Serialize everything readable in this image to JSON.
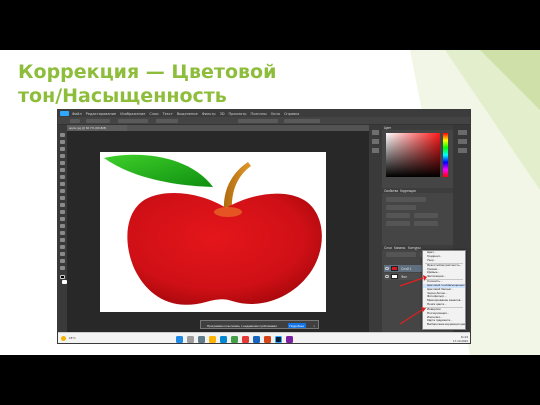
{
  "slide": {
    "title_line1": "Коррекция — Цветовой",
    "title_line2": "тон/Насыщенность",
    "accent_color": "#8dbd3b"
  },
  "photoshop": {
    "menu": [
      "Файл",
      "Редактирование",
      "Изображение",
      "Слои",
      "Текст",
      "Выделение",
      "Фильтр",
      "3D",
      "Просмотр",
      "Плагины",
      "Окно",
      "Справка"
    ],
    "document_tab": "apple.jpg @ 66.7% (RGB/8)",
    "panels": {
      "color_tab": "Цвет",
      "adjustments_tabs": [
        "Свойства",
        "Коррекция"
      ],
      "layers_tabs": [
        "Слои",
        "Каналы",
        "Контуры"
      ],
      "layers": [
        {
          "name": "Слой 1"
        },
        {
          "name": "Фон"
        }
      ]
    },
    "context_menu": {
      "items": [
        "Цвет...",
        "Градиент...",
        "Узор...",
        "---",
        "Яркость/Контрастность...",
        "Уровни...",
        "Кривые...",
        "Экспозиция...",
        "---",
        "Сочность...",
        "Цветовой тон/Насыщенность...",
        "Цветовой баланс...",
        "Черно-белое...",
        "Фотофильтр...",
        "Микширование каналов...",
        "Поиск цвета...",
        "---",
        "Инверсия",
        "Постеризация...",
        "Изогелия...",
        "Карта градиента...",
        "Выборочная коррекция цвета..."
      ],
      "highlighted": "Цветовой тон/Насыщенность..."
    },
    "notification": {
      "message": "Программа попыталась с недавними проблемами",
      "button": "Подробнее",
      "close": "×"
    },
    "taskbar": {
      "weather": "18°C",
      "time": "11:24",
      "date": "17.10.2022"
    }
  }
}
